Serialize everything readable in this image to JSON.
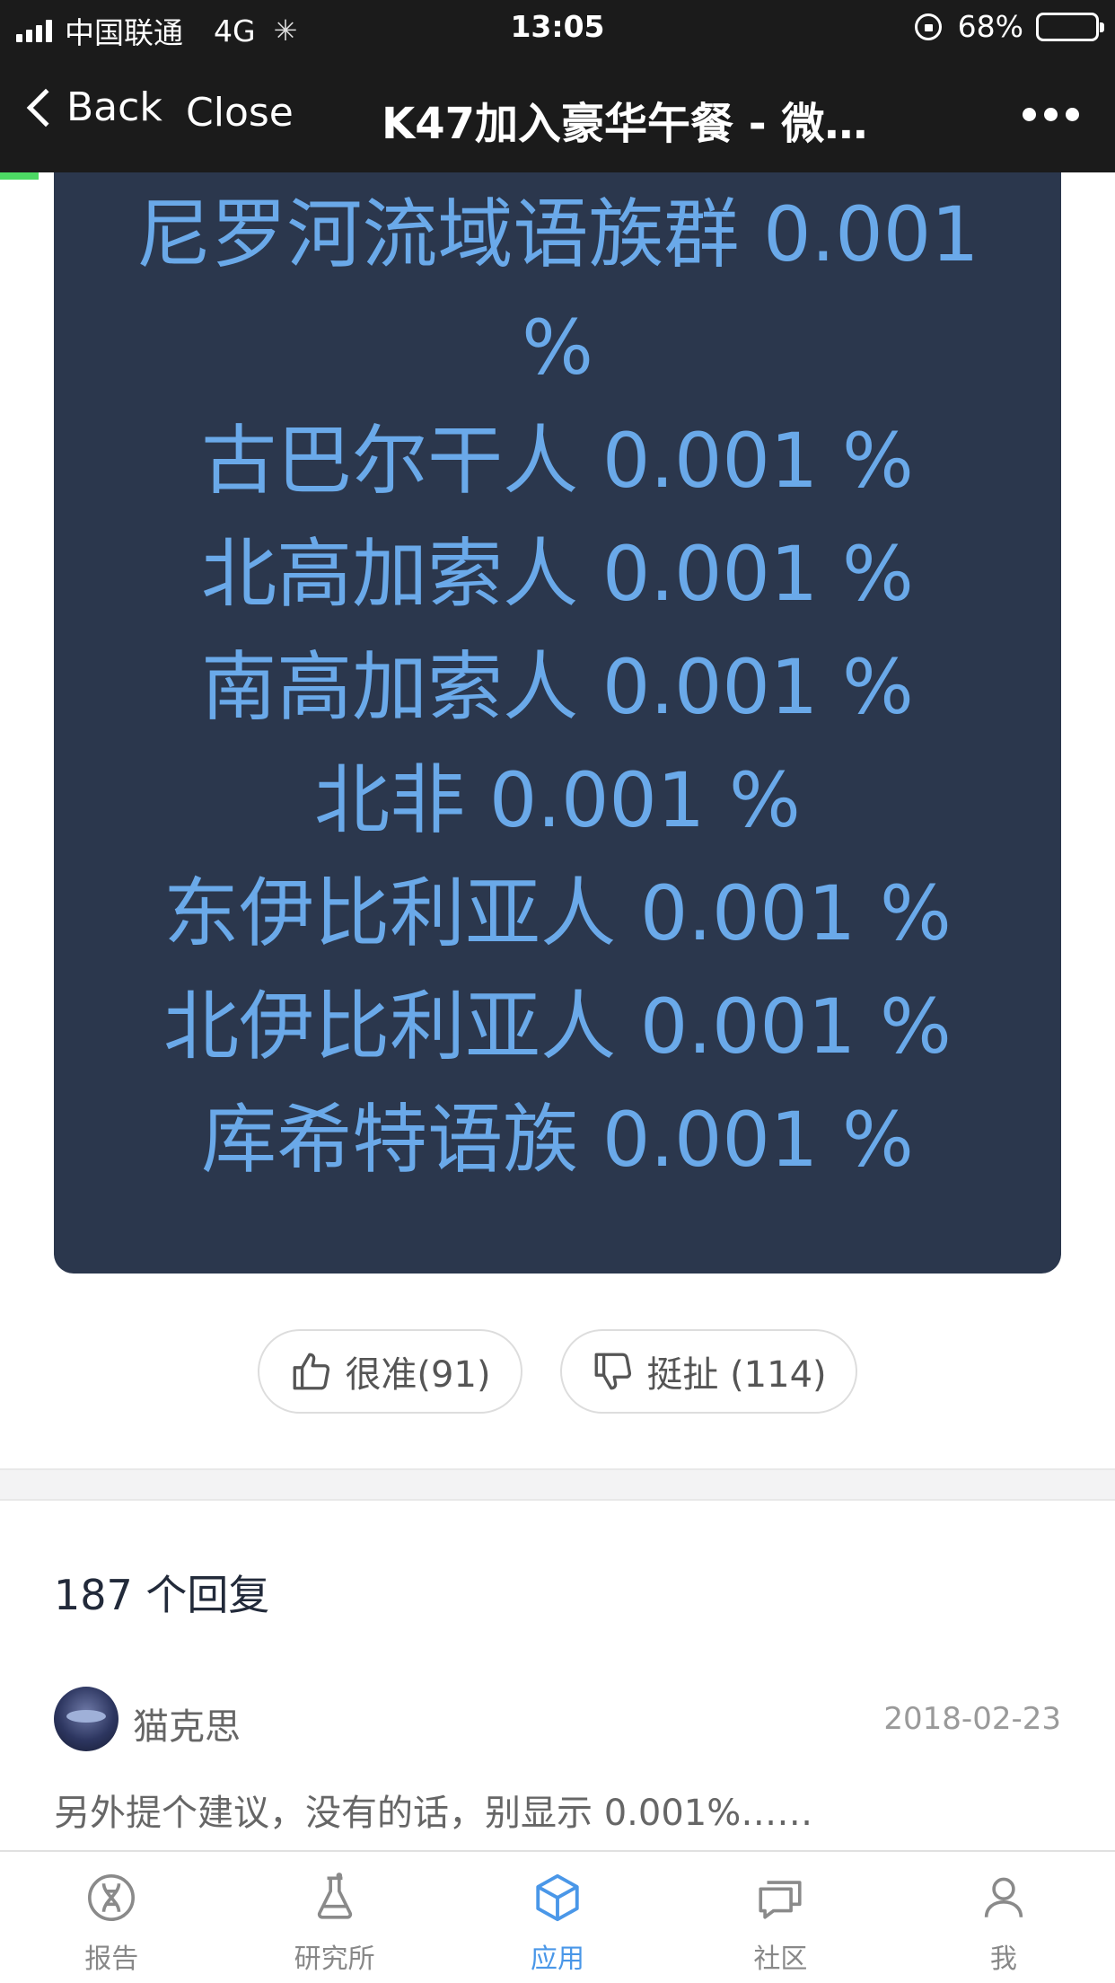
{
  "status_bar": {
    "carrier": "中国联通",
    "network": "4G",
    "time": "13:05",
    "battery": "68%",
    "battery_level": 0.68
  },
  "nav": {
    "back_label": "Back",
    "close_label": "Close",
    "title": "K47加入豪华午餐 - 微…"
  },
  "page_load_progress": 0.035,
  "results": {
    "lines": [
      "尼罗河流域语族群 0.001",
      "%",
      "古巴尔干人 0.001 %",
      "北高加索人 0.001 %",
      "南高加索人 0.001 %",
      "北非 0.001 %",
      "东伊比利亚人 0.001 %",
      "北伊比利亚人 0.001 %",
      "库希特语族 0.001 %"
    ]
  },
  "votes": {
    "up_label": "很准(91)",
    "down_label": "挺扯 (114)"
  },
  "replies": {
    "count_label": "187 个回复",
    "items": [
      {
        "author": "猫克思",
        "date": "2018-02-23",
        "text": "另外提个建议，没有的话，别显示 0.001%……"
      }
    ]
  },
  "tabs": [
    {
      "label": "报告",
      "icon": "dna-icon",
      "active": false
    },
    {
      "label": "研究所",
      "icon": "flask-icon",
      "active": false
    },
    {
      "label": "应用",
      "icon": "cube-icon",
      "active": true
    },
    {
      "label": "社区",
      "icon": "chat-icon",
      "active": false
    },
    {
      "label": "我",
      "icon": "person-icon",
      "active": false
    }
  ],
  "colors": {
    "card_bg": "#2b374d",
    "result_text": "#6aa9e9",
    "accent": "#4a97e8",
    "progress": "#4cd964"
  }
}
